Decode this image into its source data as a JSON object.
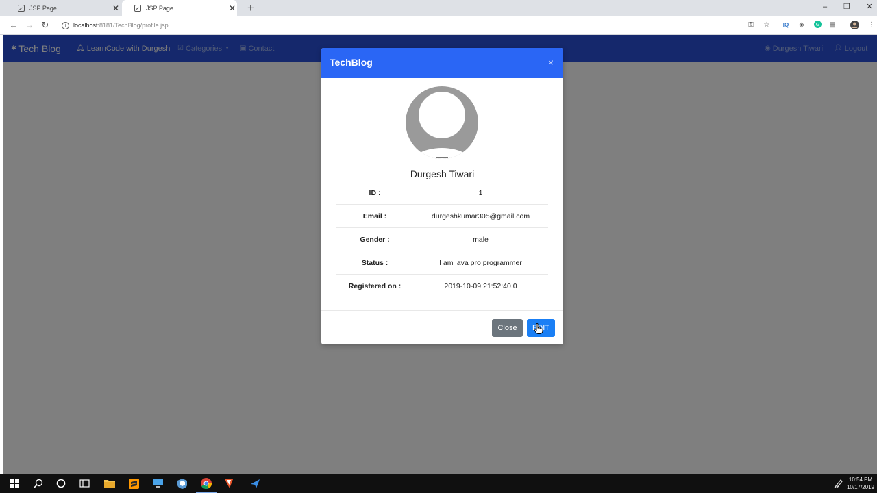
{
  "browser": {
    "tabs": [
      {
        "title": "JSP Page",
        "active": false
      },
      {
        "title": "JSP Page",
        "active": true
      }
    ],
    "new_tab_label": "+",
    "window_controls": {
      "minimize": "–",
      "restore": "❐",
      "close": "✕"
    },
    "url": {
      "host": "localhost",
      "rest": ":8181/TechBlog/profile.jsp"
    }
  },
  "navbar": {
    "brand": "Tech Blog",
    "links": [
      {
        "label": "LearnCode with Durgesh",
        "icon": "bell-icon"
      },
      {
        "label": "Categories",
        "icon": "check-square-icon"
      },
      {
        "label": "Contact",
        "icon": "address-card-icon"
      },
      {
        "label": "Durgesh Tiwari",
        "icon": "user-circle-icon"
      },
      {
        "label": "Logout",
        "icon": "user-minus-icon"
      }
    ],
    "color": "#2a50d8"
  },
  "modal": {
    "title": "TechBlog",
    "close_glyph": "×",
    "header_color": "#2a66f5",
    "name": "Durgesh Tiwari",
    "rows": [
      {
        "key": "ID :",
        "value": "1"
      },
      {
        "key": "Email :",
        "value": "durgeshkumar305@gmail.com"
      },
      {
        "key": "Gender :",
        "value": "male"
      },
      {
        "key": "Status :",
        "value": "I am java pro programmer"
      },
      {
        "key": "Registered on :",
        "value": "2019-10-09 21:52:40.0"
      }
    ],
    "buttons": {
      "close": "Close",
      "edit": "EDIT"
    }
  },
  "taskbar": {
    "time": "10:54 PM",
    "date": "10/17/2019"
  }
}
